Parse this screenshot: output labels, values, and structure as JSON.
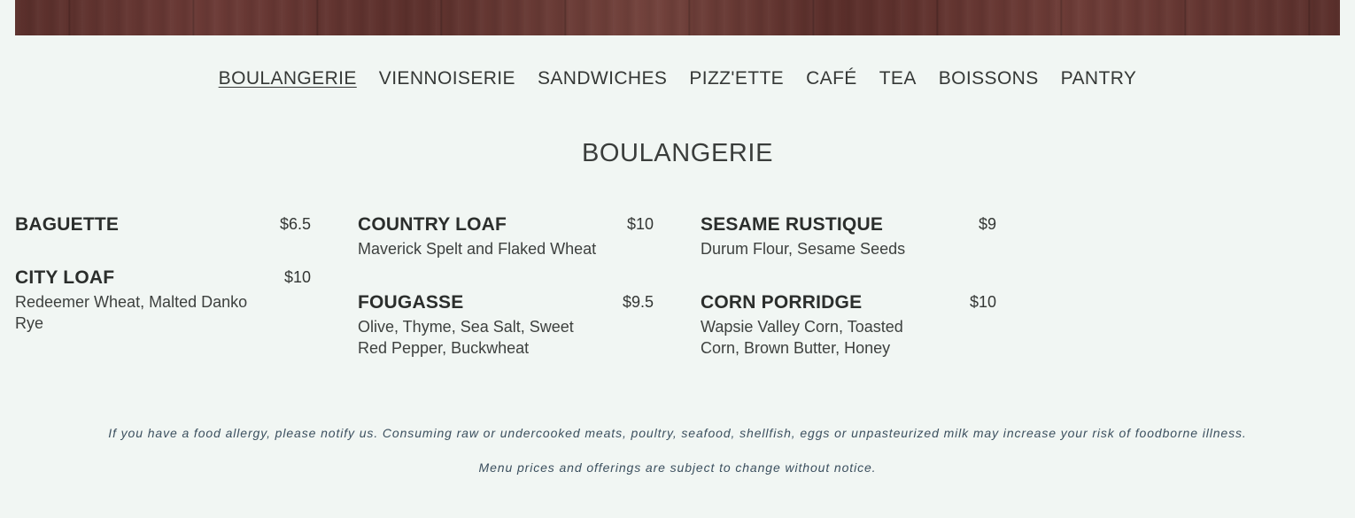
{
  "nav": {
    "items": [
      "BOULANGERIE",
      "VIENNOISERIE",
      "SANDWICHES",
      "PIZZ'ETTE",
      "CAFÉ",
      "TEA",
      "BOISSONS",
      "PANTRY"
    ],
    "active": "BOULANGERIE"
  },
  "section": {
    "title": "BOULANGERIE"
  },
  "menu": [
    {
      "name": "BAGUETTE",
      "price": "$6.5",
      "description": ""
    },
    {
      "name": "CITY LOAF",
      "price": "$10",
      "description": "Redeemer Wheat, Malted Danko Rye"
    },
    {
      "name": "COUNTRY LOAF",
      "price": "$10",
      "description": "Maverick Spelt and Flaked Wheat"
    },
    {
      "name": "FOUGASSE",
      "price": "$9.5",
      "description": "Olive, Thyme, Sea Salt, Sweet Red Pepper, Buckwheat"
    },
    {
      "name": "SESAME RUSTIQUE",
      "price": "$9",
      "description": "Durum Flour, Sesame Seeds"
    },
    {
      "name": "CORN PORRIDGE",
      "price": "$10",
      "description": "Wapsie Valley Corn, Toasted Corn, Brown Butter, Honey"
    }
  ],
  "footer": {
    "allergy_notice": "If you have a food allergy, please notify us. Consuming raw or undercooked meats, poultry, seafood, shellfish, eggs or unpasteurized milk may increase your risk of foodborne illness.",
    "change_notice": "Menu prices and offerings are subject to change without notice."
  },
  "colors": {
    "background": "#f1f6f3",
    "hero_wood": "#5f332f",
    "footer_text": "#3b4f5e"
  }
}
